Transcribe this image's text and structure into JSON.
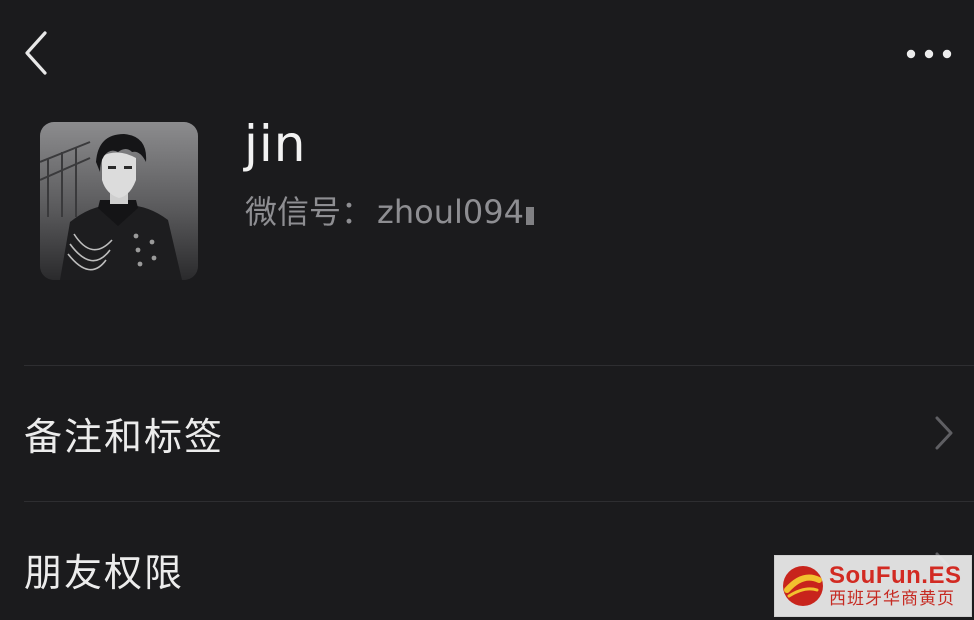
{
  "header": {
    "back_icon": "chevron-left-icon",
    "more_icon": "more-horizontal-icon"
  },
  "profile": {
    "name": "jin",
    "wechat_id_label": "微信号",
    "wechat_id_separator": "：",
    "wechat_id_value": "zhoul094"
  },
  "menu": {
    "items": [
      {
        "label": "备注和标签"
      },
      {
        "label": "朋友权限"
      }
    ],
    "chevron_icon": "chevron-right-icon"
  },
  "watermark": {
    "brand": "SouFun.ES",
    "subtitle": "西班牙华商黄页"
  },
  "colors": {
    "background": "#1b1b1d",
    "primary_text": "#ececec",
    "secondary_text": "#8e8e92",
    "divider": "#2e2e31",
    "watermark_red": "#d22a22"
  }
}
